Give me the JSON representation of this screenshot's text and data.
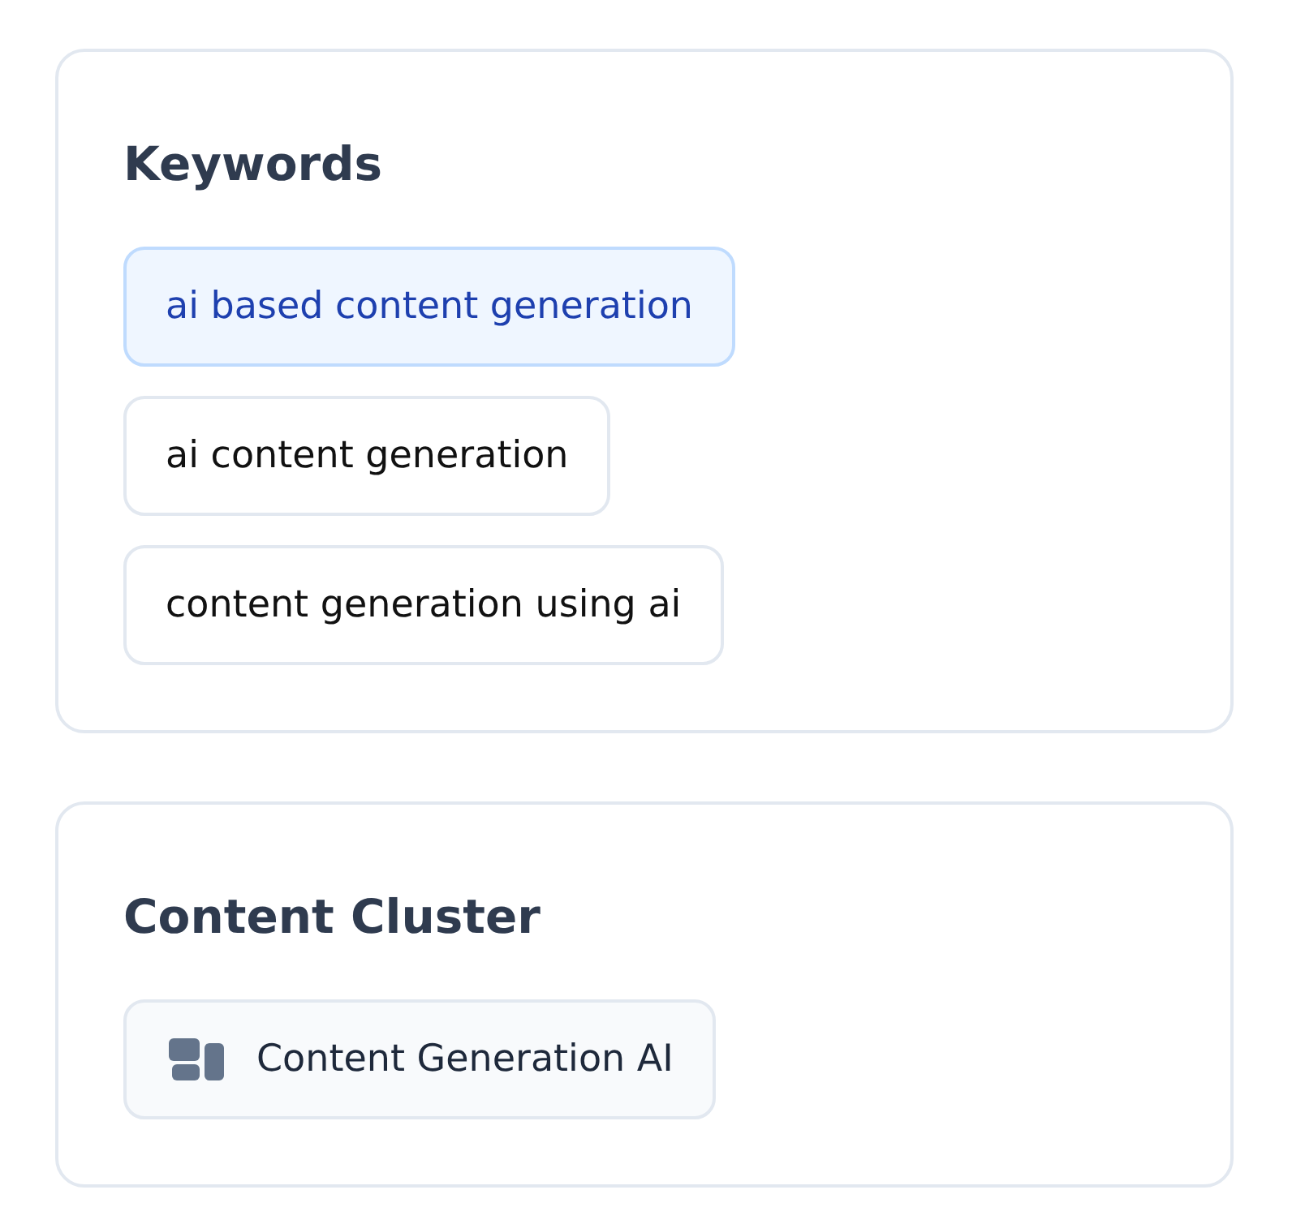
{
  "keywords": {
    "title": "Keywords",
    "items": [
      {
        "label": "ai based content generation",
        "selected": true
      },
      {
        "label": "ai content generation",
        "selected": false
      },
      {
        "label": "content generation using ai",
        "selected": false
      }
    ]
  },
  "content_cluster": {
    "title": "Content Cluster",
    "items": [
      {
        "label": "Content Generation AI"
      }
    ]
  }
}
